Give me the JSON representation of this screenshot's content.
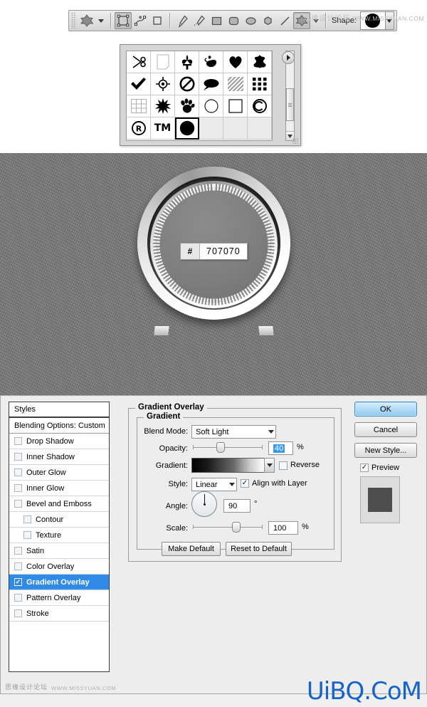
{
  "options_bar": {
    "tool_preset_icon": "custom-shape-preset-icon",
    "preset_caret": "chevron-down-icon",
    "mode_buttons": [
      {
        "name": "shape-layers-button",
        "icon": "shape-layers-icon"
      },
      {
        "name": "paths-button",
        "icon": "paths-icon"
      },
      {
        "name": "fill-pixels-button",
        "icon": "fill-pixels-icon"
      }
    ],
    "tool_buttons": [
      {
        "name": "pen-tool-button",
        "icon": "pen-icon"
      },
      {
        "name": "freeform-pen-tool-button",
        "icon": "freeform-pen-icon"
      },
      {
        "name": "rectangle-tool-button",
        "icon": "rectangle-icon"
      },
      {
        "name": "rounded-rectangle-tool-button",
        "icon": "rounded-rectangle-icon"
      },
      {
        "name": "ellipse-tool-button",
        "icon": "ellipse-icon"
      },
      {
        "name": "polygon-tool-button",
        "icon": "polygon-icon"
      },
      {
        "name": "line-tool-button",
        "icon": "line-icon"
      },
      {
        "name": "custom-shape-tool-button",
        "icon": "custom-shape-icon"
      }
    ],
    "shape_label": "Shape:",
    "shape_swatch": "filled-circle-shape",
    "shape_caret": "chevron-down-icon"
  },
  "watermarks": {
    "top_right_cn": "思缘设计论坛",
    "top_right_url": "WWW.MISSYUAN.COM",
    "bottom_cn": "思缘设计论坛",
    "bottom_url": "WWW.MISSYUAN.COM",
    "bottom_big": "UiBQ.CoM",
    "big_color": "#1664c8"
  },
  "shape_picker": {
    "menu_icon": "picker-menu-icon",
    "scroll_up_icon": "scroll-up-arrow-icon",
    "scroll_down_icon": "scroll-down-arrow-icon",
    "selected_index": 20,
    "shapes": [
      {
        "name": "scissors-shape",
        "glyph": "✂"
      },
      {
        "name": "paper-sheet-shape",
        "glyph": ""
      },
      {
        "name": "fleur-de-lis-shape",
        "glyph": "⚜"
      },
      {
        "name": "bird-ornament-shape",
        "glyph": "❧"
      },
      {
        "name": "heart-shape",
        "glyph": "♥"
      },
      {
        "name": "splat-shape",
        "glyph": "✹"
      },
      {
        "name": "check-mark-shape",
        "glyph": "✔"
      },
      {
        "name": "target-registration-shape",
        "glyph": "⌖"
      },
      {
        "name": "no-entry-shape",
        "glyph": "⃠"
      },
      {
        "name": "speech-bubble-shape",
        "glyph": ""
      },
      {
        "name": "diagonal-hatch-shape",
        "glyph": ""
      },
      {
        "name": "dot-grid-shape",
        "glyph": ""
      },
      {
        "name": "grid-shape",
        "glyph": ""
      },
      {
        "name": "starburst-shape",
        "glyph": "✹"
      },
      {
        "name": "paw-print-shape",
        "glyph": ""
      },
      {
        "name": "circle-outline-shape",
        "glyph": "○"
      },
      {
        "name": "square-outline-shape",
        "glyph": "□"
      },
      {
        "name": "copyright-shape",
        "glyph": "©"
      },
      {
        "name": "registered-shape",
        "glyph": "®"
      },
      {
        "name": "trademark-shape",
        "glyph": "TM"
      },
      {
        "name": "filled-circle-shape",
        "glyph": "●"
      }
    ]
  },
  "canvas": {
    "background_color": "#7a7a7a",
    "knob_name": "dial-knob-graphic",
    "hex_field": {
      "prefix": "#",
      "value": "707070"
    }
  },
  "dialog": {
    "styles_panel": {
      "header": "Styles",
      "blending_options": "Blending Options: Custom",
      "items": [
        {
          "label": "Drop Shadow",
          "checked": false,
          "indent": false
        },
        {
          "label": "Inner Shadow",
          "checked": false,
          "indent": false
        },
        {
          "label": "Outer Glow",
          "checked": false,
          "indent": false
        },
        {
          "label": "Inner Glow",
          "checked": false,
          "indent": false
        },
        {
          "label": "Bevel and Emboss",
          "checked": false,
          "indent": false
        },
        {
          "label": "Contour",
          "checked": false,
          "indent": true
        },
        {
          "label": "Texture",
          "checked": false,
          "indent": true
        },
        {
          "label": "Satin",
          "checked": false,
          "indent": false
        },
        {
          "label": "Color Overlay",
          "checked": false,
          "indent": false
        },
        {
          "label": "Gradient Overlay",
          "checked": true,
          "indent": false,
          "active": true
        },
        {
          "label": "Pattern Overlay",
          "checked": false,
          "indent": false
        },
        {
          "label": "Stroke",
          "checked": false,
          "indent": false
        }
      ]
    },
    "panel": {
      "section_title": "Gradient Overlay",
      "group_title": "Gradient",
      "blend_mode": {
        "label": "Blend Mode:",
        "value": "Soft Light"
      },
      "opacity": {
        "label": "Opacity:",
        "value": "40",
        "unit": "%",
        "percent": 40
      },
      "gradient": {
        "label": "Gradient:",
        "preset": "black-to-white"
      },
      "reverse": {
        "label": "Reverse",
        "checked": false
      },
      "style": {
        "label": "Style:",
        "value": "Linear"
      },
      "align_with_layer": {
        "label": "Align with Layer",
        "checked": true
      },
      "angle": {
        "label": "Angle:",
        "value": "90",
        "unit": "°"
      },
      "scale": {
        "label": "Scale:",
        "value": "100",
        "unit": "%",
        "percent": 100
      },
      "make_default": "Make Default",
      "reset_to_default": "Reset to Default"
    },
    "buttons": {
      "ok": "OK",
      "cancel": "Cancel",
      "new_style": "New Style...",
      "preview": {
        "label": "Preview",
        "checked": true
      },
      "preview_swatch_color": "#4d4d4d"
    }
  }
}
